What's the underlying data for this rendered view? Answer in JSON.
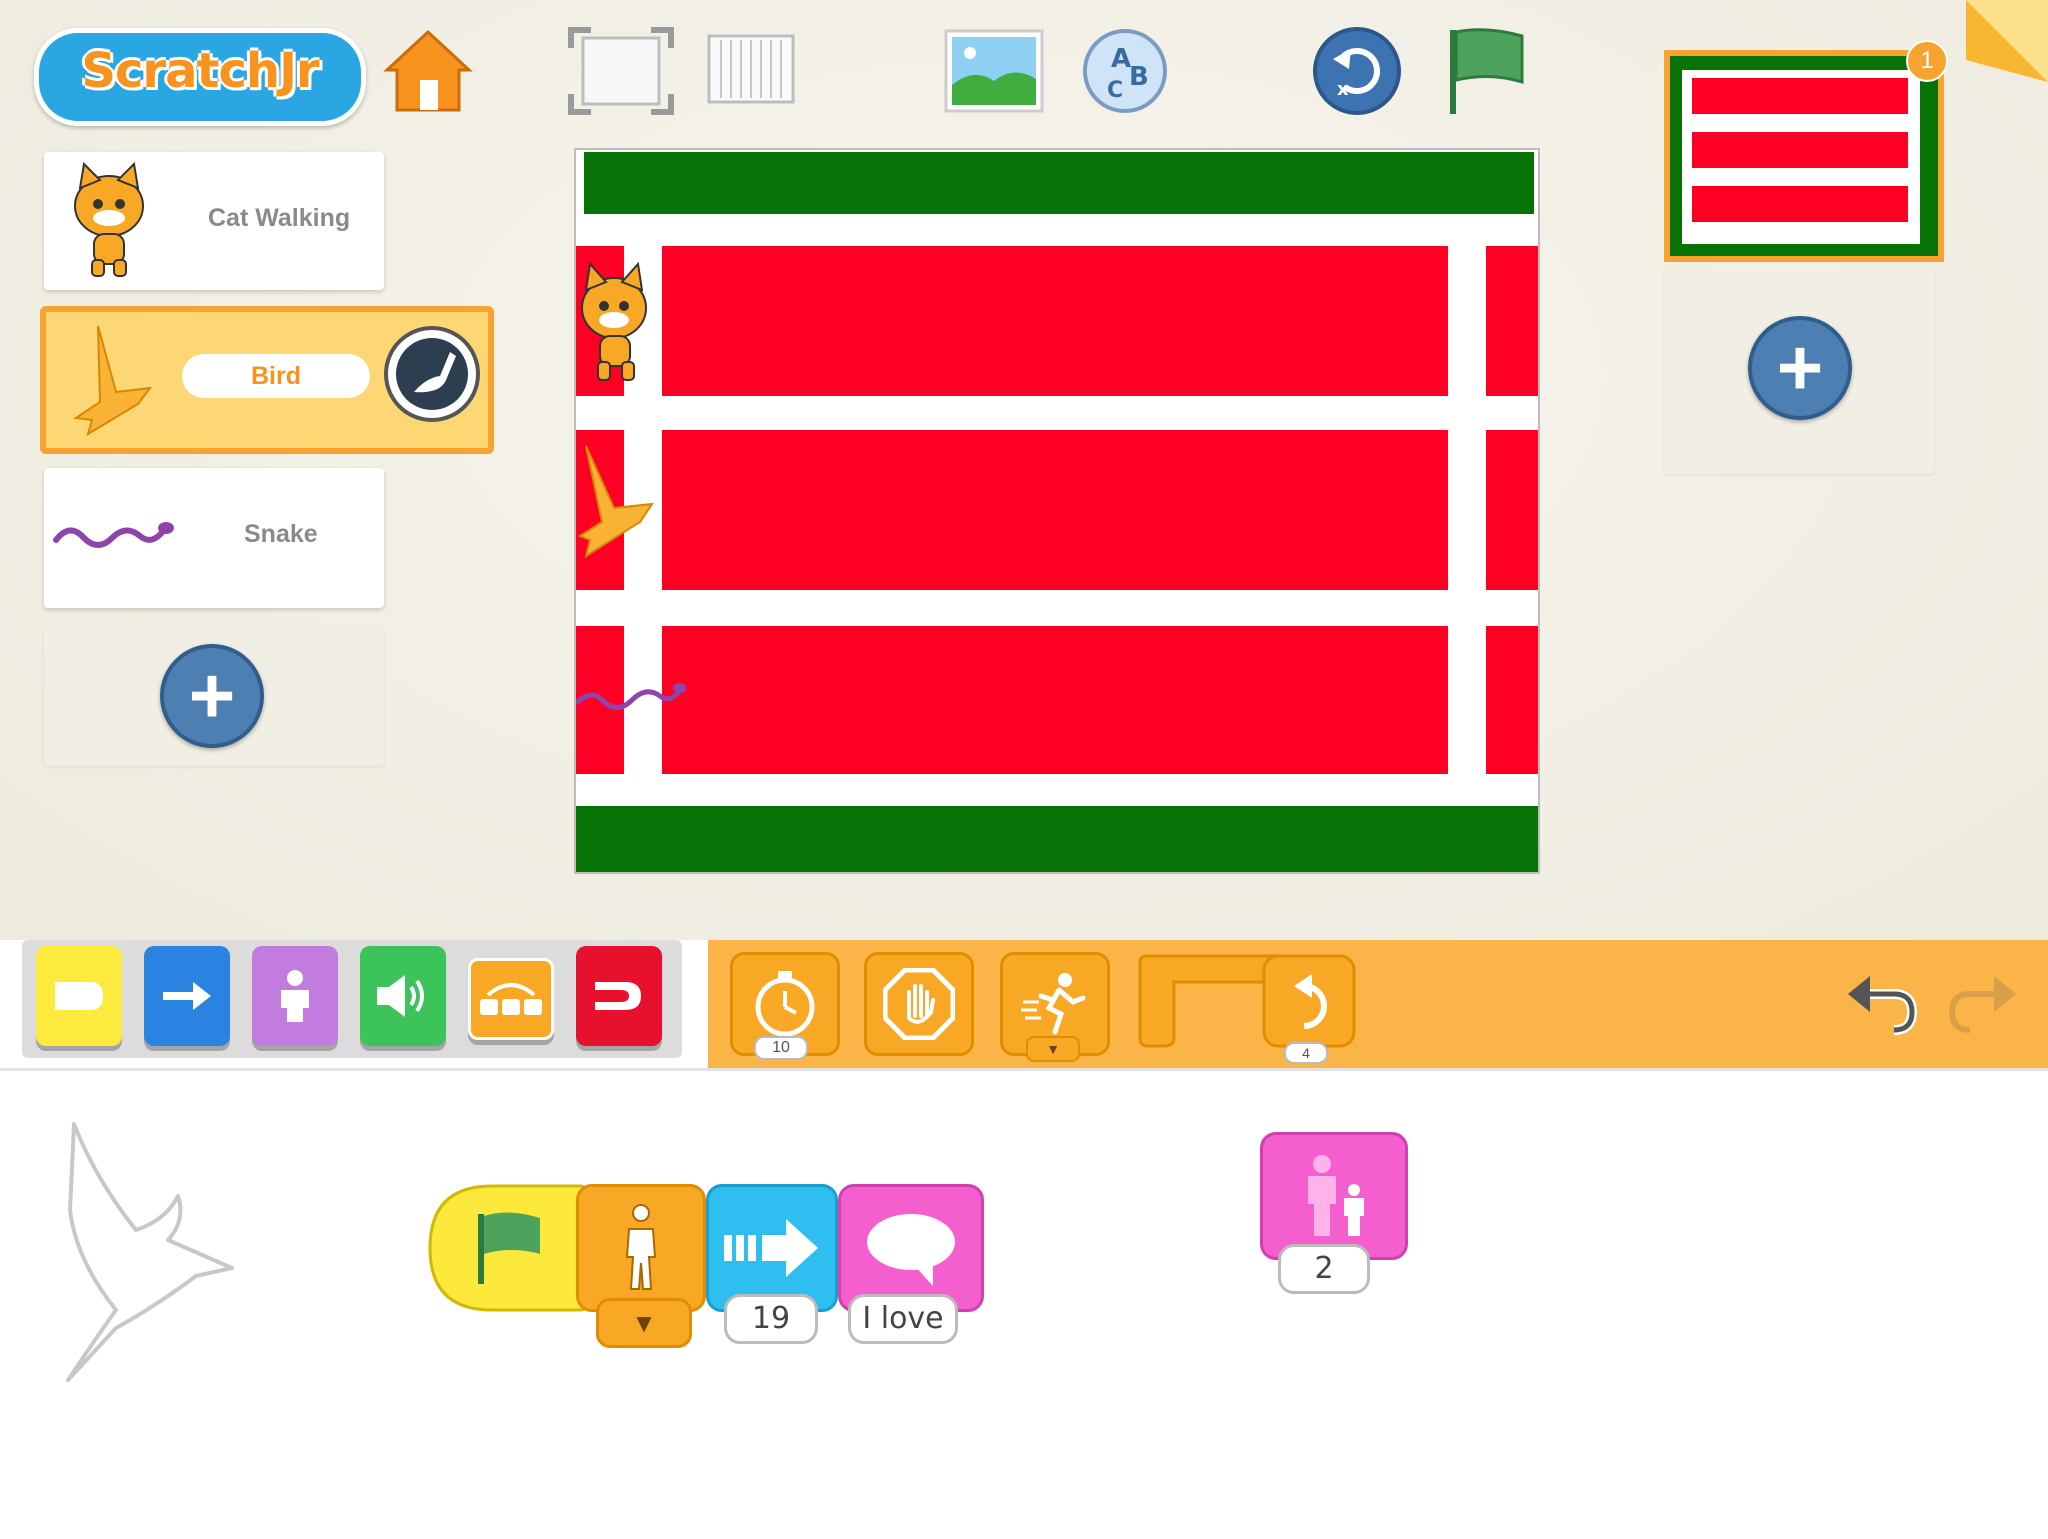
{
  "app": {
    "logo_text": "ScratchJr"
  },
  "sprites": [
    {
      "name": "Cat Walking",
      "selected": false
    },
    {
      "name": "Bird",
      "selected": true
    },
    {
      "name": "Snake",
      "selected": false
    }
  ],
  "pages": {
    "count_badge": "1"
  },
  "categories": [
    {
      "name": "triggering",
      "color": "#fdea3f"
    },
    {
      "name": "motion",
      "color": "#2a83e0"
    },
    {
      "name": "looks",
      "color": "#c27ce0"
    },
    {
      "name": "sound",
      "color": "#3cc45a"
    },
    {
      "name": "control",
      "color": "#f9a825"
    },
    {
      "name": "end",
      "color": "#e8112d"
    }
  ],
  "palette": {
    "wait_value": "10",
    "repeat_value": "4"
  },
  "script": {
    "move_right_value": "19",
    "say_value": "I love",
    "grow_value": "2"
  },
  "colors": {
    "stage_green": "#077307",
    "stage_red": "#fe0023",
    "accent_orange": "#f7a332",
    "plus_blue": "#4d7fb2"
  }
}
